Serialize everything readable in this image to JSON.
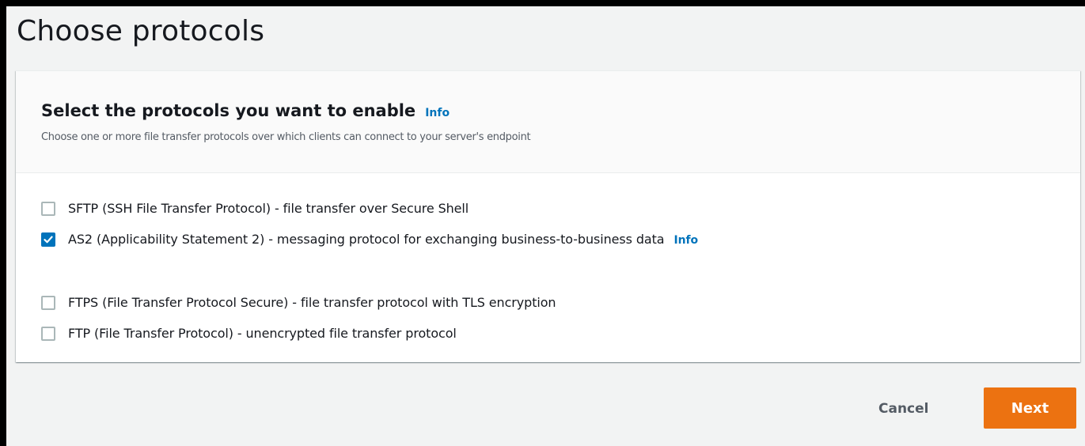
{
  "page": {
    "title": "Choose protocols"
  },
  "container": {
    "title": "Select the protocols you want to enable",
    "info_label": "Info",
    "description": "Choose one or more file transfer protocols over which clients can connect to your server's endpoint"
  },
  "protocols": [
    {
      "label": "SFTP (SSH File Transfer Protocol) - file transfer over Secure Shell",
      "checked": false
    },
    {
      "label": "AS2 (Applicability Statement 2) - messaging protocol for exchanging business-to-business data",
      "checked": true,
      "info_label": "Info"
    },
    {
      "label": "FTPS (File Transfer Protocol Secure) - file transfer protocol with TLS encryption",
      "checked": false
    },
    {
      "label": "FTP (File Transfer Protocol) - unencrypted file transfer protocol",
      "checked": false
    }
  ],
  "footer": {
    "cancel_label": "Cancel",
    "next_label": "Next"
  },
  "colors": {
    "accent": "#0073bb",
    "primary_button": "#ec7211",
    "background": "#f2f3f3"
  }
}
